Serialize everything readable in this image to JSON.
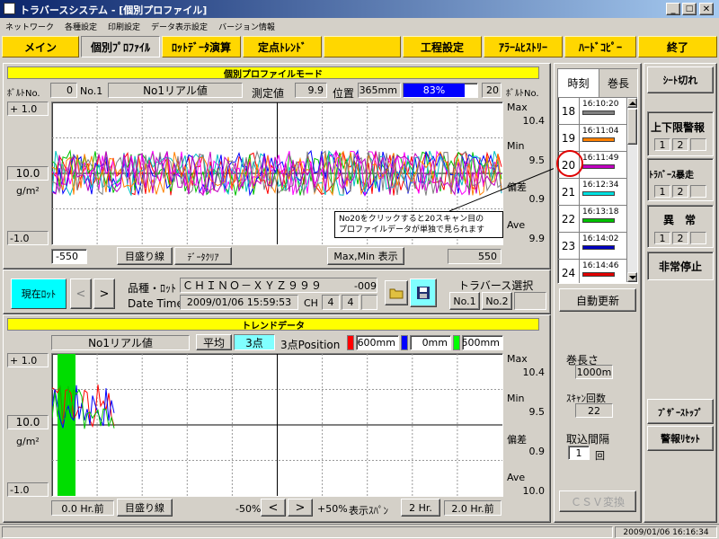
{
  "titlebar": {
    "title": "トラバースシステム - [個別プロファイル]"
  },
  "menu": [
    "ネットワーク",
    "各種設定",
    "印刷設定",
    "データ表示設定",
    "バージョン情報"
  ],
  "nav": [
    "メイン",
    "個別ﾌﾟﾛﾌｧｲﾙ",
    "ﾛｯﾄﾃﾞｰﾀ演算",
    "定点ﾄﾚﾝﾄﾞ",
    "工程設定",
    "ｱﾗｰﾑﾋｽﾄﾘｰ",
    "ﾊｰﾄﾞｺﾋﾟｰ",
    "終了"
  ],
  "profile": {
    "header": "個別プロファイルモード",
    "bolt_left_label": "ﾎﾞﾙﾄNo.",
    "bolt_left_value": "0",
    "no_label": "No.1",
    "channel_name": "No1リアル値",
    "meas_label": "測定値",
    "meas_value": "9.9",
    "pos_label": "位置",
    "pos_value": "365mm",
    "progress_text": "83%",
    "progress": 0.83,
    "bolt_right_value": "20",
    "bolt_right_label": "ﾎﾞﾙﾄNo.",
    "y_top": "+ 1.0",
    "y_mid": "10.0",
    "unit": "g/m²",
    "y_bot": "-1.0",
    "max_label": "Max",
    "max_value": "10.4",
    "min_label": "Min",
    "min_value": "9.5",
    "dev_label": "偏差",
    "dev_value": "0.9",
    "ave_label": "Ave",
    "ave_value": "9.9",
    "tooltip_line1": "No20をクリックすると20スキャン目の",
    "tooltip_line2": "プロファイルデータが単独で見られます",
    "x_left": "-550",
    "scale_btn": "目盛り線",
    "clear_btn": "ﾃﾞｰﾀｸﾘｱ",
    "maxmin_btn": "Max,Min 表示",
    "x_right": "550"
  },
  "lot": {
    "current_lot_btn": "現在ﾛｯﾄ",
    "prev": "<",
    "next": ">",
    "product_label": "品種・ﾛｯﾄ",
    "product_value": "ＣＨＩＮＯ－ＸＹＺ９９９",
    "product_suffix": "-009",
    "datetime_label": "Date Time",
    "datetime_value": "2009/01/06 15:59:53",
    "ch_label": "CH",
    "ch_value1": "4",
    "ch_value2": "4",
    "traverse_label": "トラバース選択",
    "trav_no1": "No.1",
    "trav_no2": "No.2"
  },
  "trend": {
    "header": "トレンドデータ",
    "channel_name": "No1リアル値",
    "avg_btn": "平均",
    "pts_btn": "3点",
    "pos_label": "3点Position",
    "pos1": "-600mm",
    "pos2": "0mm",
    "pos3": "500mm",
    "y_top": "+ 1.0",
    "y_mid": "10.0",
    "unit": "g/m²",
    "y_bot": "-1.0",
    "max_label": "Max",
    "max_value": "10.4",
    "min_label": "Min",
    "min_value": "9.5",
    "dev_label": "偏差",
    "dev_value": "0.9",
    "ave_label": "Ave",
    "ave_value": "10.0",
    "x_left": "0.0 Hr.前",
    "scale_btn": "目盛り線",
    "minus_label": "-50%",
    "lt": "<",
    "gt": ">",
    "plus_label": "+50%",
    "span_label": "表示ｽﾊﾟﾝ",
    "span_value": "2 Hr.",
    "x_right": "2.0 Hr.前"
  },
  "scanlist": {
    "tab_time": "時刻",
    "tab_length": "巻長",
    "rows": [
      {
        "no": "18",
        "time": "16:10:20",
        "color": "#808080"
      },
      {
        "no": "19",
        "time": "16:11:04",
        "color": "#ff8000"
      },
      {
        "no": "20",
        "time": "16:11:49",
        "color": "#c000c0"
      },
      {
        "no": "21",
        "time": "16:12:34",
        "color": "#00e0e0"
      },
      {
        "no": "22",
        "time": "16:13:18",
        "color": "#00c000"
      },
      {
        "no": "23",
        "time": "16:14:02",
        "color": "#0000c0"
      },
      {
        "no": "24",
        "time": "16:14:46",
        "color": "#e00000"
      }
    ],
    "auto_update": "自動更新",
    "length_label": "巻長さ",
    "length_value": "1000m",
    "scan_count_label": "ｽｷｬﾝ回数",
    "scan_count_value": "22",
    "interval_label": "取込間隔",
    "interval_value": "1",
    "interval_unit": "回",
    "csv_btn": "ＣＳＶ変換"
  },
  "right": {
    "sheet_break": "ｼｰﾄ切れ",
    "limit_alarm": "上下限警報",
    "limit_1": "1",
    "limit_2": "2",
    "runaway": "ﾄﾗﾊﾞｰｽ暴走",
    "runaway_1": "1",
    "runaway_2": "2",
    "abnormal": "異　常",
    "abnormal_1": "1",
    "abnormal_2": "2",
    "emergency": "非常停止",
    "buzzer_stop": "ﾌﾞｻﾞｰｽﾄｯﾌﾟ",
    "alarm_reset": "警報ﾘｾｯﾄ"
  },
  "status": {
    "datetime": "2009/01/06 16:16:34"
  },
  "colors": {
    "title_start": "#0a246a",
    "title_end": "#a6caf0",
    "nav_yellow": "#ffd700",
    "header_yellow": "#ffff00",
    "cyan": "#80ffff",
    "progress_blue": "#0000ff",
    "trend_green": "#00dd00"
  }
}
